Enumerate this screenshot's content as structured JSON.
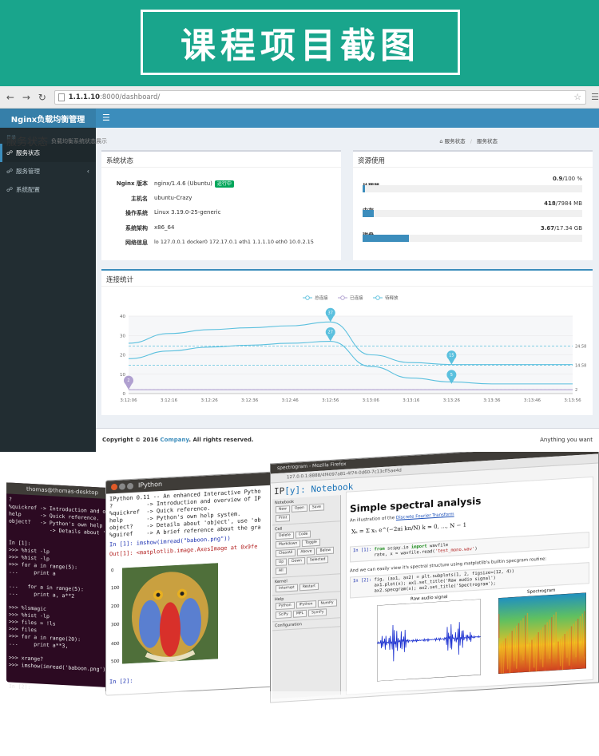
{
  "banner": {
    "title": "课程项目截图",
    "bg_color": "#19a58c"
  },
  "browser": {
    "url_host": "1.1.1.10",
    "url_rest": ":8000/dashboard/",
    "back_icon": "arrow-left-icon",
    "forward_icon": "arrow-right-icon",
    "reload_icon": "reload-icon"
  },
  "app": {
    "logo": "Nginx负载均衡管理",
    "sidebar": {
      "header": "目录",
      "items": [
        {
          "label": "服务状态",
          "active": true
        },
        {
          "label": "服务管理",
          "active": false
        },
        {
          "label": "系统配置",
          "active": false
        }
      ]
    },
    "content": {
      "title": "服务状态",
      "subtitle": "负载均衡系统状态展示",
      "breadcrumb": [
        "服务状态",
        "服务状态"
      ]
    },
    "system": {
      "title": "系统状态",
      "rows": [
        {
          "label": "Nginx 版本",
          "value": "nginx/1.4.6 (Ubuntu)",
          "badge": "运行中"
        },
        {
          "label": "主机名",
          "value": "ubuntu-Crazy"
        },
        {
          "label": "操作系统",
          "value": "Linux 3.19.0-25-generic"
        },
        {
          "label": "系统架构",
          "value": "x86_64"
        },
        {
          "label": "网络信息",
          "value": "lo 127.0.0.1 docker0 172.17.0.1 eth1 1.1.1.10 eth0 10.0.2.15"
        }
      ]
    },
    "resources": {
      "title": "资源使用",
      "items": [
        {
          "label": "处理器",
          "used": "0.9",
          "total": "/100 %",
          "fraction": 0.009
        },
        {
          "label": "内存",
          "used": "418",
          "total": "/7984 MB",
          "fraction": 0.052
        },
        {
          "label": "磁盘",
          "used": "3.67",
          "total": "/17.34 GB",
          "fraction": 0.212
        }
      ]
    },
    "connections": {
      "title": "连接统计"
    },
    "footer": {
      "copyright_prefix": "Copyright © 2016 ",
      "company": "Company",
      "copyright_suffix": ". All rights reserved.",
      "right": "Anything you want"
    }
  },
  "chart_data": {
    "type": "line",
    "title": "连接统计",
    "legend": [
      "总连接",
      "已连接",
      "待释放"
    ],
    "legend_position": "top-center",
    "x": [
      "3:12:06",
      "3:12:16",
      "3:12:26",
      "3:12:36",
      "3:12:46",
      "3:12:56",
      "3:13:06",
      "3:13:16",
      "3:13:26",
      "3:13:36",
      "3:13:46",
      "3:13:56"
    ],
    "ylim": [
      0,
      40
    ],
    "yticks": [
      0,
      10,
      20,
      30,
      40
    ],
    "series": [
      {
        "name": "总连接",
        "values": [
          26,
          31,
          33,
          34,
          35,
          37,
          20,
          16,
          15,
          15,
          15,
          15
        ],
        "color": "#5bc0de"
      },
      {
        "name": "已连接",
        "values": [
          2,
          2,
          2,
          2,
          2,
          2,
          2,
          2,
          2,
          2,
          2,
          2
        ],
        "color": "#b0a0d0"
      },
      {
        "name": "待释放",
        "values": [
          18,
          22,
          24,
          25,
          26,
          27,
          14,
          8,
          6,
          5,
          5,
          5
        ],
        "color": "#5bc0de"
      }
    ],
    "markers": [
      {
        "series": "总连接",
        "x": "3:12:56",
        "value": 37
      },
      {
        "series": "待释放",
        "x": "3:12:56",
        "value": 27
      },
      {
        "series": "总连接",
        "x": "3:13:26",
        "value": 15
      },
      {
        "series": "待释放",
        "x": "3:13:26",
        "value": 5
      },
      {
        "series": "已连接",
        "x": "3:12:06",
        "value": 2
      }
    ],
    "mark_lines": [
      {
        "label": "24.58",
        "value": 24.58
      },
      {
        "label": "14.58",
        "value": 14.58
      },
      {
        "label": "2",
        "value": 2
      }
    ]
  },
  "bottom": {
    "terminal": {
      "title": "thomas@thomas-desktop",
      "lines": "?\n%quickref -> Introduction and o\nhelp      -> Quick reference.\nobject?   -> Python's own help\n             -> Details about 'obj\n\nIn [1]:\n>>> %hist -lp\n>>> %hist -lp\n>>> for a in range(5):\n...     print a\n\n...   for a in range(5):\n...     print a, a**2\n\n>>> %lsmagic\n>>> %hist -lp\n>>> files = !ls\n>>> files\n>>> for a in range(20):\n...     print a**3,\n\n>>> xrange?\n>>> imshow(imread('baboon.png'))\n\n\nIn [2]:"
    },
    "ipython": {
      "title": "IPython",
      "lines": "IPython 0.11 -- An enhanced Interactive Pytho\n?          -> Introduction and overview of IP\n%quickref  -> Quick reference.\nhelp       -> Python's own help system.\nobject?    -> Details about 'object', use 'ob\n%guiref    -> A brief reference about the gra",
      "in1": "In [1]: imshow(imread(\"baboon.png\"))",
      "out1": "Out[1]: <matplotlib.image.AxesImage at 0x9fe",
      "in2": "In [2]:",
      "axis": [
        "0",
        "100",
        "200",
        "300",
        "400",
        "500"
      ]
    },
    "notebook": {
      "window_title": "spectrogram - Mozilla Firefox",
      "url": "127.0.0.1:8888/4f4097a81-4f74-0d60-7c13cff5ae4d",
      "logo_prefix": "IP",
      "logo_y": "[y]",
      "logo_suffix": ": Notebook",
      "heading": "Simple spectral analysis",
      "intro_prefix": "An illustration of the ",
      "intro_link": "Discrete Fourier Transform",
      "formula": "Xₖ = Σ xₙ e^(−2πi kn/N)     k = 0, ..., N − 1",
      "cell1_prompt": "In [1]:",
      "cell1_a": "from",
      "cell1_b": " scipy.io ",
      "cell1_c": "import",
      "cell1_d": " wavfile",
      "cell1_e": "rate, x = wavfile.read(",
      "cell1_f": "'test_mono.wav'",
      "cell1_g": ")",
      "text2": "And we can easily view it's spectral structure using matplotlib's builtin specgram routine:",
      "cell2_prompt": "In [2]:",
      "cell2_l1": "fig, (ax1, ax2) = plt.subplots(1, 2, figsize=(12, 4))",
      "cell2_l2": "ax1.plot(x); ax1.set_title('Raw audio signal')",
      "cell2_l3": "ax2.specgram(x); ax2.set_title('Spectrogram');",
      "plot1_title": "Raw audio signal",
      "plot2_title": "Spectrogram",
      "panel_sections": [
        "Notebook",
        "Cell",
        "Kernel",
        "Help",
        "Configuration"
      ]
    }
  }
}
